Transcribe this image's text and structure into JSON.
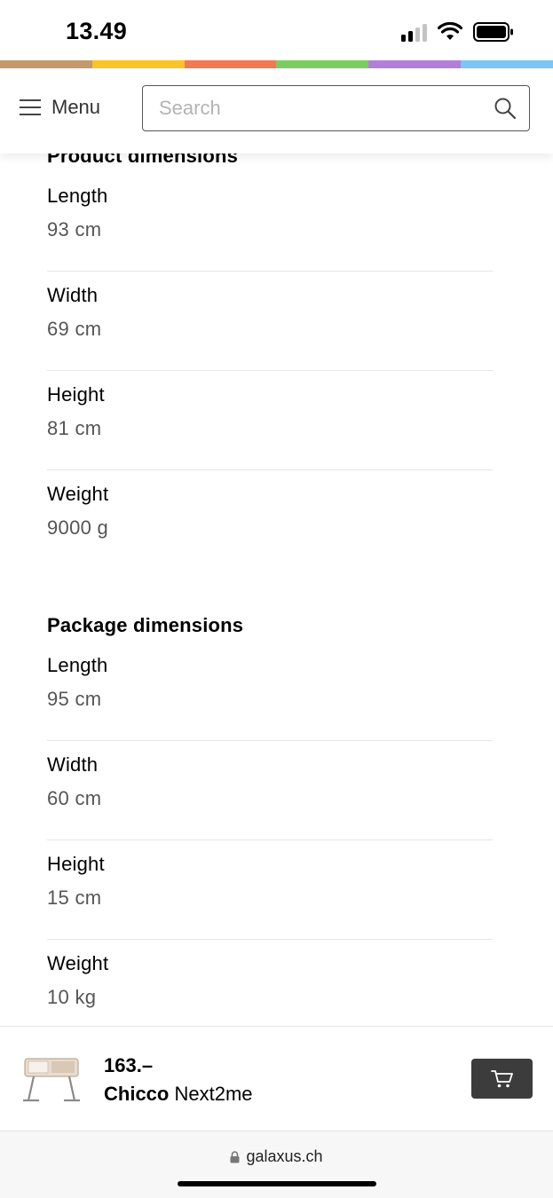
{
  "status_bar": {
    "time": "13.49",
    "icons": [
      "cellular-signal-icon",
      "wifi-icon",
      "battery-icon"
    ]
  },
  "color_stripe": [
    "#c49a6c",
    "#f9c32b",
    "#f07a55",
    "#7dcb63",
    "#b27fd6",
    "#7ec5f2"
  ],
  "header": {
    "menu_label": "Menu",
    "search_placeholder": "Search",
    "search_value": ""
  },
  "product_dimensions": {
    "title": "Product dimensions",
    "rows": [
      {
        "label": "Length",
        "value": "93 cm"
      },
      {
        "label": "Width",
        "value": "69 cm"
      },
      {
        "label": "Height",
        "value": "81 cm"
      },
      {
        "label": "Weight",
        "value": "9000 g"
      }
    ]
  },
  "package_dimensions": {
    "title": "Package dimensions",
    "rows": [
      {
        "label": "Length",
        "value": "95 cm"
      },
      {
        "label": "Width",
        "value": "60 cm"
      },
      {
        "label": "Height",
        "value": "15 cm"
      },
      {
        "label": "Weight",
        "value": "10 kg"
      }
    ]
  },
  "product_bar": {
    "price": "163.–",
    "brand": "Chicco",
    "model": "Next2me",
    "cart_icon": "shopping-cart-icon"
  },
  "browser": {
    "url": "galaxus.ch",
    "lock_icon": "lock-icon"
  }
}
